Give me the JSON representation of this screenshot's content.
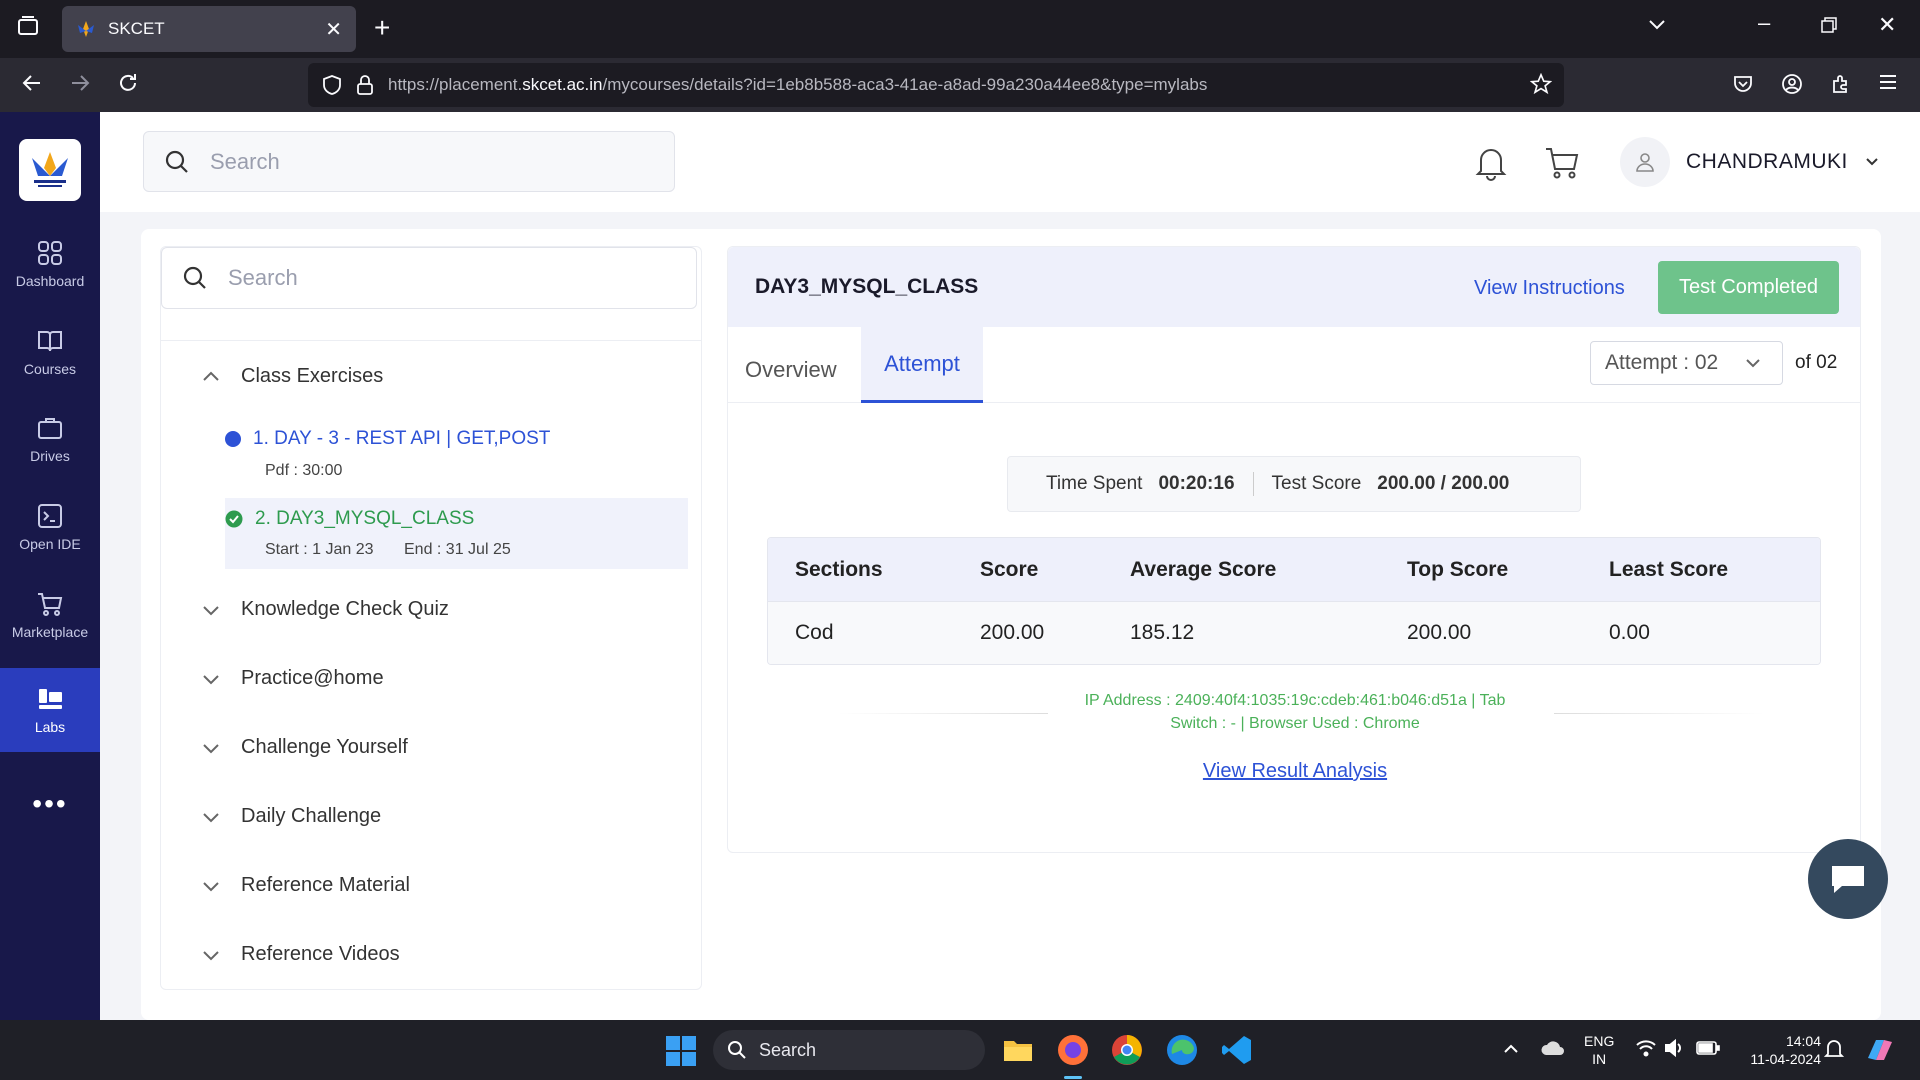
{
  "browser": {
    "tab_title": "SKCET",
    "url_prefix": "https://placement.",
    "url_domain": "skcet.ac.in",
    "url_path": "/mycourses/details?id=1eb8b588-aca3-41ae-a8ad-99a230a44ee8&type=mylabs"
  },
  "sidebar": {
    "items": [
      {
        "label": "Dashboard"
      },
      {
        "label": "Courses"
      },
      {
        "label": "Drives"
      },
      {
        "label": "Open IDE"
      },
      {
        "label": "Marketplace"
      },
      {
        "label": "Labs"
      }
    ]
  },
  "header": {
    "search_placeholder": "Search",
    "username": "CHANDRAMUKI"
  },
  "left_panel": {
    "search_placeholder": "Search",
    "sections": [
      {
        "label": "Class Exercises"
      },
      {
        "label": "Knowledge Check Quiz"
      },
      {
        "label": "Practice@home"
      },
      {
        "label": "Challenge Yourself"
      },
      {
        "label": "Daily Challenge"
      },
      {
        "label": "Reference Material"
      },
      {
        "label": "Reference Videos"
      }
    ],
    "exercises": [
      {
        "title": "1. DAY - 3 - REST API | GET,POST",
        "sub": "Pdf : 30:00",
        "color": "#2d52d6"
      },
      {
        "title": "2. DAY3_MYSQL_CLASS",
        "start": "Start : 1 Jan 23",
        "end": "End : 31 Jul 25",
        "color": "#2e9b4e"
      }
    ]
  },
  "test": {
    "title": "DAY3_MYSQL_CLASS",
    "view_instructions": "View Instructions",
    "status": "Test Completed",
    "tabs": {
      "overview": "Overview",
      "attempt": "Attempt"
    },
    "attempt_label": "Attempt : 02",
    "of_total": "of 02",
    "time_spent_label": "Time Spent",
    "time_spent": "00:20:16",
    "test_score_label": "Test Score",
    "test_score": "200.00 / 200.00",
    "table": {
      "headers": [
        "Sections",
        "Score",
        "Average Score",
        "Top Score",
        "Least Score"
      ],
      "rows": [
        [
          "Cod",
          "200.00",
          "185.12",
          "200.00",
          "0.00"
        ]
      ]
    },
    "ip_line1": "IP Address : 2409:40f4:1035:19c:cdeb:461:b046:d51a | Tab",
    "ip_line2": "Switch : - | Browser Used : Chrome",
    "result_link": "View Result Analysis"
  },
  "taskbar": {
    "search": "Search",
    "lang1": "ENG",
    "lang2": "IN",
    "time": "14:04",
    "date": "11-04-2024"
  }
}
